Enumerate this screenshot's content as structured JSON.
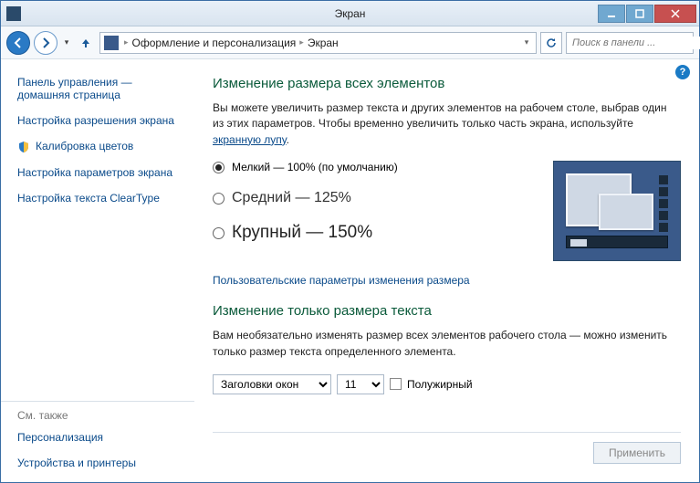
{
  "titlebar": {
    "title": "Экран"
  },
  "breadcrumb": {
    "item1": "Оформление и персонализация",
    "item2": "Экран"
  },
  "search": {
    "placeholder": "Поиск в панели ..."
  },
  "sidebar": {
    "links": [
      "Панель управления — домашняя страница",
      "Настройка разрешения экрана",
      "Калибровка цветов",
      "Настройка параметров экрана",
      "Настройка текста ClearType"
    ],
    "see_also_heading": "См. также",
    "see_also": [
      "Персонализация",
      "Устройства и принтеры"
    ]
  },
  "content": {
    "h1": "Изменение размера всех элементов",
    "p1_pre": "Вы можете увеличить размер текста и других элементов на рабочем столе, выбрав один из этих параметров. Чтобы временно увеличить только часть экрана, используйте ",
    "p1_link": "экранную лупу",
    "p1_post": ".",
    "radios": {
      "small": "Мелкий — 100% (по умолчанию)",
      "medium": "Средний — 125%",
      "large": "Крупный — 150%"
    },
    "custom_link": "Пользовательские параметры изменения размера",
    "h2": "Изменение только размера текста",
    "p2": "Вам необязательно изменять размер всех элементов рабочего стола — можно изменить только размер текста определенного элемента.",
    "select_element": "Заголовки окон",
    "select_size": "11",
    "bold_label": "Полужирный",
    "apply": "Применить"
  }
}
